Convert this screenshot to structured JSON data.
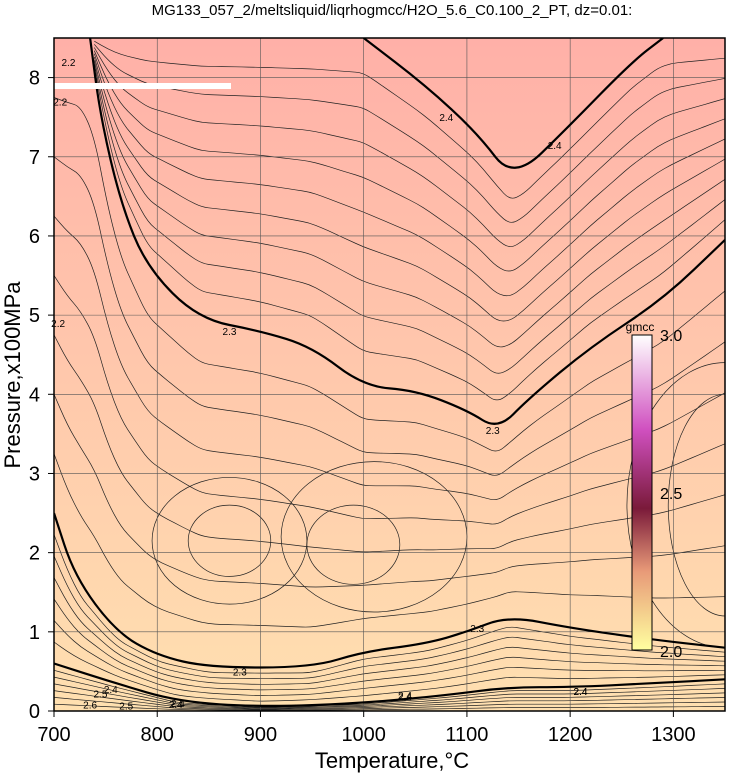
{
  "chart_data": {
    "type": "contour",
    "title": "MG133_057_2/meltsliquid/liqrhogmcc/H2O_5.6_C0.100_2_PT, dz=0.01:",
    "xlabel": "Temperature,°C",
    "ylabel": "Pressure,x100MPa",
    "xlim": [
      700,
      1350
    ],
    "ylim": [
      0,
      8.5
    ],
    "x_ticks": [
      700,
      800,
      900,
      1000,
      1100,
      1200,
      1300
    ],
    "y_ticks": [
      0,
      1,
      2,
      3,
      4,
      5,
      6,
      7,
      8
    ],
    "grid": true,
    "contour_interval": 0.01,
    "bold_contours": [
      {
        "level": "2.4",
        "points": [
          [
            1000,
            8.5
          ],
          [
            1060,
            7.9
          ],
          [
            1110,
            7.3
          ],
          [
            1145,
            6.7
          ],
          [
            1200,
            7.4
          ],
          [
            1260,
            8.2
          ],
          [
            1290,
            8.5
          ]
        ],
        "labels": [
          [
            1080,
            7.5
          ],
          [
            1185,
            7.15
          ]
        ]
      },
      {
        "level": "2.3",
        "points": [
          [
            735,
            8.5
          ],
          [
            745,
            7.5
          ],
          [
            765,
            6.4
          ],
          [
            790,
            5.6
          ],
          [
            840,
            4.95
          ],
          [
            900,
            4.8
          ],
          [
            950,
            4.6
          ],
          [
            1000,
            4.1
          ],
          [
            1050,
            4.05
          ],
          [
            1100,
            3.8
          ],
          [
            1130,
            3.55
          ],
          [
            1160,
            3.95
          ],
          [
            1220,
            4.6
          ],
          [
            1290,
            5.2
          ],
          [
            1350,
            5.95
          ]
        ],
        "labels": [
          [
            870,
            4.8
          ],
          [
            1125,
            3.55
          ]
        ]
      },
      {
        "level": "2.3",
        "points": [
          [
            700,
            2.5
          ],
          [
            720,
            1.7
          ],
          [
            760,
            1.0
          ],
          [
            800,
            0.7
          ],
          [
            850,
            0.55
          ],
          [
            950,
            0.55
          ],
          [
            1000,
            0.75
          ],
          [
            1060,
            0.85
          ],
          [
            1100,
            1.0
          ],
          [
            1140,
            1.2
          ],
          [
            1200,
            1.05
          ],
          [
            1280,
            0.9
          ],
          [
            1350,
            0.8
          ]
        ],
        "labels": [
          [
            880,
            0.5
          ],
          [
            1110,
            1.05
          ]
        ]
      },
      {
        "level": "2.4",
        "points": [
          [
            700,
            0.6
          ],
          [
            760,
            0.35
          ],
          [
            820,
            0.12
          ],
          [
            900,
            0.05
          ],
          [
            1000,
            0.1
          ],
          [
            1080,
            0.2
          ],
          [
            1140,
            0.3
          ],
          [
            1200,
            0.3
          ],
          [
            1280,
            0.35
          ],
          [
            1350,
            0.4
          ]
        ],
        "labels": [
          [
            820,
            0.1
          ],
          [
            1040,
            0.2
          ],
          [
            1210,
            0.25
          ]
        ]
      }
    ],
    "inline_labels": [
      {
        "text": "2.4",
        "x": 1040,
        "y": 0.18
      },
      {
        "text": "2.4",
        "x": 1210,
        "y": 0.25
      },
      {
        "text": "2.4",
        "x": 818,
        "y": 0.09
      },
      {
        "text": "2.4",
        "x": 755,
        "y": 0.28
      },
      {
        "text": "2.5",
        "x": 745,
        "y": 0.22
      },
      {
        "text": "2.5",
        "x": 770,
        "y": 0.07
      },
      {
        "text": "2.6",
        "x": 735,
        "y": 0.08
      },
      {
        "text": "2.2",
        "x": 706,
        "y": 7.7
      },
      {
        "text": "2.2",
        "x": 704,
        "y": 4.9
      },
      {
        "text": "2.2",
        "x": 714,
        "y": 8.2
      }
    ],
    "colorbar": {
      "label": "gmcc",
      "min": 2.0,
      "max": 3.0,
      "ticks": [
        "3.0",
        "2.5",
        "2.0"
      ],
      "colors": [
        "#ffffa0",
        "#e89a78",
        "#7a1a3a",
        "#d050c0",
        "#ffffff"
      ]
    },
    "background_colors": {
      "top": "#ffb0a8",
      "bottom": "#ffe0b0"
    }
  }
}
